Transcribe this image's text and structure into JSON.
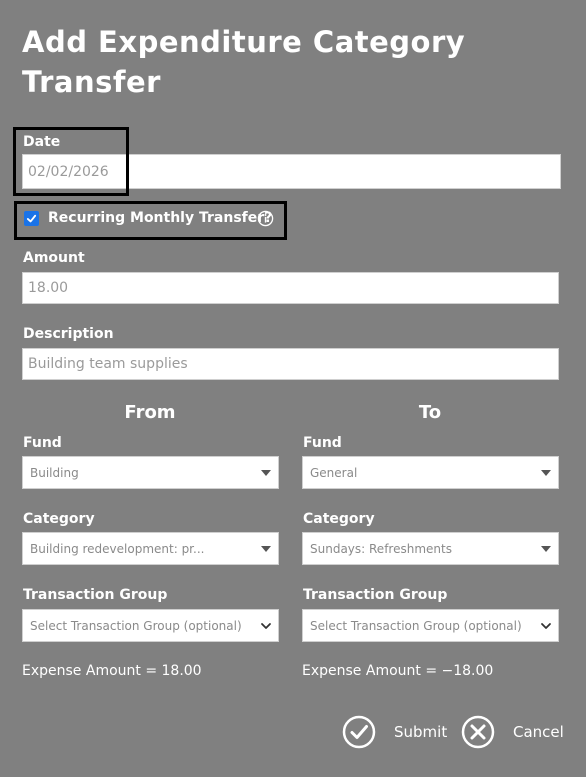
{
  "dialog": {
    "title": "Add Expenditure Category Transfer"
  },
  "date": {
    "label": "Date",
    "value": "02/02/2026"
  },
  "recurring": {
    "label": "Recurring Monthly Transfer?",
    "checked": true,
    "info_icon": "info-icon"
  },
  "amount": {
    "label": "Amount",
    "value": "18.00"
  },
  "description": {
    "label": "Description",
    "value": "Building team supplies"
  },
  "from": {
    "heading": "From",
    "fund_label": "Fund",
    "fund_value": "Building",
    "category_label": "Category",
    "category_value": "Building redevelopment: pr...",
    "group_label": "Transaction Group",
    "group_value": "Select Transaction Group (optional)",
    "expense_amount": "Expense Amount = 18.00"
  },
  "to": {
    "heading": "To",
    "fund_label": "Fund",
    "fund_value": "General",
    "category_label": "Category",
    "category_value": "Sundays: Refreshments",
    "group_label": "Transaction Group",
    "group_value": "Select Transaction Group (optional)",
    "expense_amount": "Expense Amount = −18.00"
  },
  "actions": {
    "submit_label": "Submit",
    "cancel_label": "Cancel",
    "submit_icon": "check-circle-icon",
    "cancel_icon": "x-circle-icon"
  },
  "colors": {
    "background": "#808080",
    "checkbox_accent": "#1a73e8",
    "highlight_border": "#000000"
  }
}
